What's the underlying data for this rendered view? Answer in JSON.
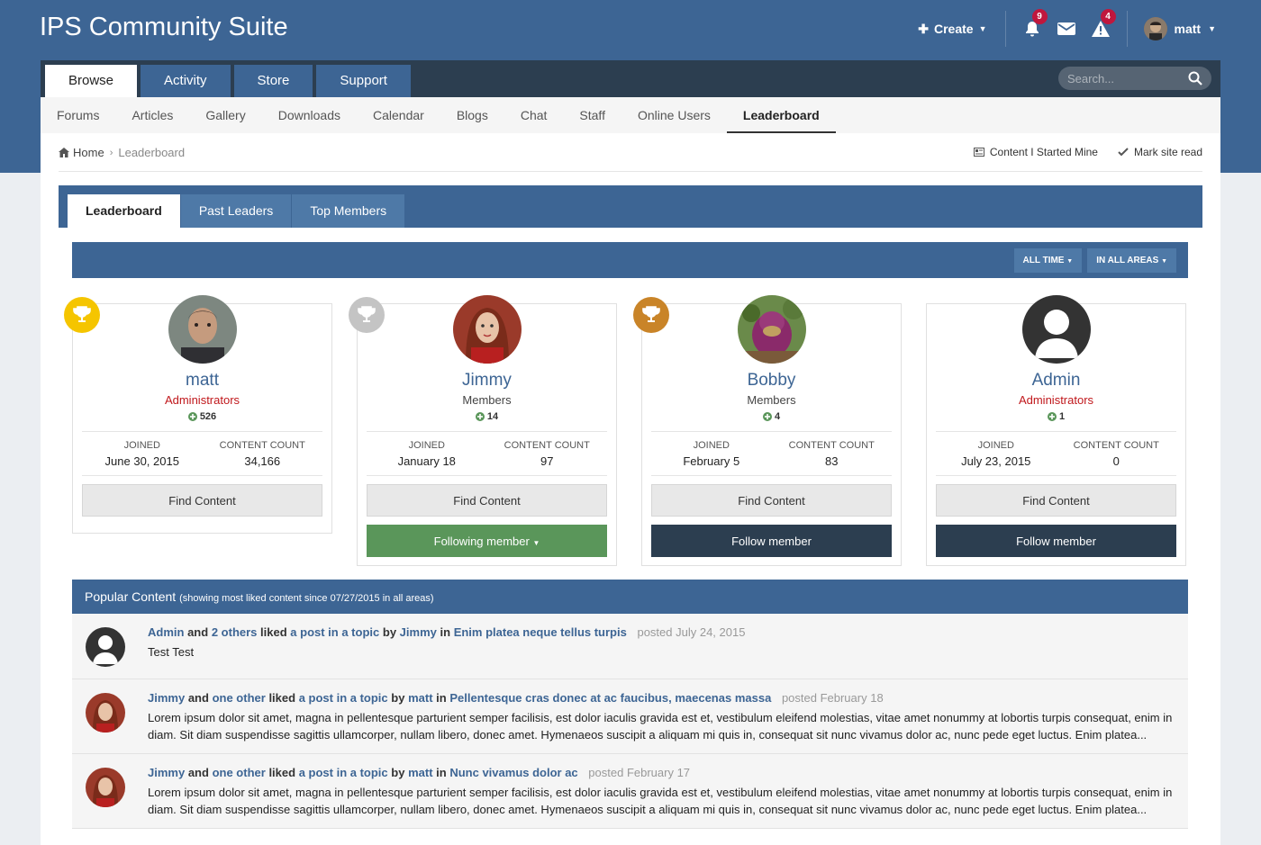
{
  "header": {
    "site_title": "IPS Community Suite",
    "create_label": "Create",
    "notifications_count": "9",
    "reports_count": "4",
    "username": "matt"
  },
  "nav": {
    "tabs": [
      {
        "label": "Browse",
        "active": true
      },
      {
        "label": "Activity",
        "active": false
      },
      {
        "label": "Store",
        "active": false
      },
      {
        "label": "Support",
        "active": false
      }
    ],
    "search_placeholder": "Search..."
  },
  "subnav": {
    "items": [
      {
        "label": "Forums"
      },
      {
        "label": "Articles"
      },
      {
        "label": "Gallery"
      },
      {
        "label": "Downloads"
      },
      {
        "label": "Calendar"
      },
      {
        "label": "Blogs"
      },
      {
        "label": "Chat"
      },
      {
        "label": "Staff"
      },
      {
        "label": "Online Users"
      },
      {
        "label": "Leaderboard"
      }
    ]
  },
  "breadcrumb": {
    "home": "Home",
    "current": "Leaderboard"
  },
  "page_actions": {
    "content_started": "Content I Started Mine",
    "mark_read": "Mark site read"
  },
  "tabs": {
    "leaderboard": "Leaderboard",
    "past_leaders": "Past Leaders",
    "top_members": "Top Members"
  },
  "filters": {
    "time": "ALL TIME",
    "areas": "IN ALL AREAS"
  },
  "labels": {
    "joined": "JOINED",
    "content_count": "CONTENT COUNT",
    "find_content": "Find Content"
  },
  "leaders": [
    {
      "name": "matt",
      "group": "Administrators",
      "rep": "526",
      "joined": "June 30, 2015",
      "content_count": "34,166",
      "trophy_color": "#f5c500"
    },
    {
      "name": "Jimmy",
      "group": "Members",
      "rep": "14",
      "joined": "January 18",
      "content_count": "97",
      "follow_label": "Following member",
      "trophy_color": "#c4c4c4"
    },
    {
      "name": "Bobby",
      "group": "Members",
      "rep": "4",
      "joined": "February 5",
      "content_count": "83",
      "follow_label": "Follow member",
      "trophy_color": "#c98428"
    },
    {
      "name": "Admin",
      "group": "Administrators",
      "rep": "1",
      "joined": "July 23, 2015",
      "content_count": "0",
      "follow_label": "Follow member"
    }
  ],
  "popular": {
    "title": "Popular Content",
    "subtitle": "(showing most liked content since 07/27/2015 in all areas)",
    "items": [
      {
        "user": "Admin",
        "and": "and",
        "others": "2 others",
        "liked": "liked",
        "what": "a post in a topic",
        "by": "by",
        "author": "Jimmy",
        "in": "in",
        "topic": "Enim platea neque tellus turpis",
        "posted": "posted July 24, 2015",
        "text": "Test Test"
      },
      {
        "user": "Jimmy",
        "and": "and",
        "others": "one other",
        "liked": "liked",
        "what": "a post in a topic",
        "by": "by",
        "author": "matt",
        "in": "in",
        "topic": "Pellentesque cras donec at ac faucibus, maecenas massa",
        "posted": "posted February 18",
        "text": "Lorem ipsum dolor sit amet, magna in pellentesque parturient semper facilisis, est dolor iaculis gravida est et, vestibulum eleifend molestias, vitae amet nonummy at lobortis turpis consequat, enim in diam. Sit diam suspendisse sagittis ullamcorper, nullam libero, donec amet. Hymenaeos suscipit a aliquam mi quis in, consequat sit nunc vivamus dolor ac, nunc pede eget luctus. Enim platea..."
      },
      {
        "user": "Jimmy",
        "and": "and",
        "others": "one other",
        "liked": "liked",
        "what": "a post in a topic",
        "by": "by",
        "author": "matt",
        "in": "in",
        "topic": "Nunc vivamus dolor ac",
        "posted": "posted February 17",
        "text": "Lorem ipsum dolor sit amet, magna in pellentesque parturient semper facilisis, est dolor iaculis gravida est et, vestibulum eleifend molestias, vitae amet nonummy at lobortis turpis consequat, enim in diam. Sit diam suspendisse sagittis ullamcorper, nullam libero, donec amet. Hymenaeos suscipit a aliquam mi quis in, consequat sit nunc vivamus dolor ac, nunc pede eget luctus. Enim platea..."
      }
    ]
  }
}
